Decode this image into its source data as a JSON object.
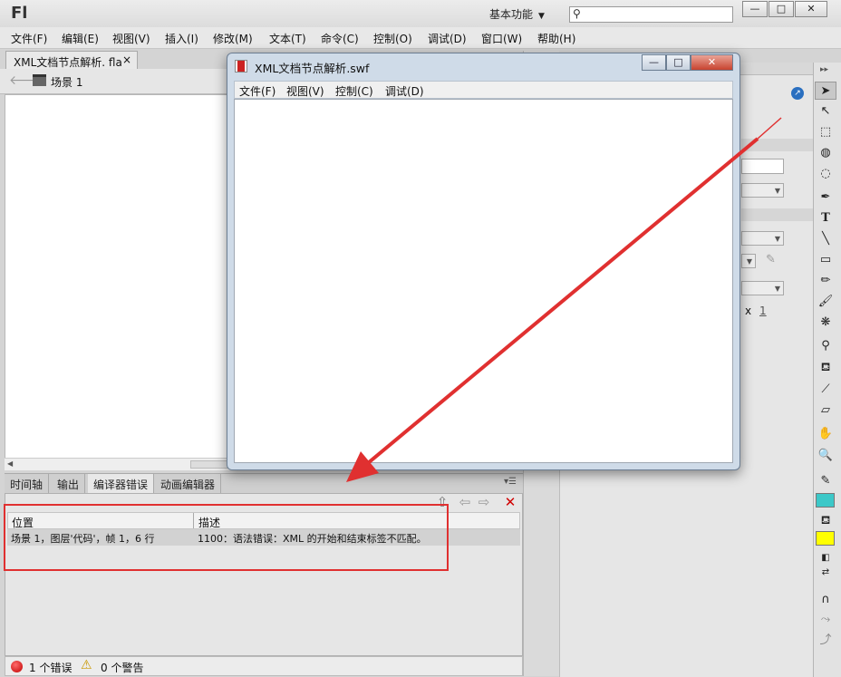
{
  "app": {
    "logo": "Fl",
    "workspace": "基本功能"
  },
  "window_buttons": {
    "minimize": "—",
    "maximize": "□",
    "close": "✕"
  },
  "menu": [
    "文件(F)",
    "编辑(E)",
    "视图(V)",
    "插入(I)",
    "修改(M)",
    "文本(T)",
    "命令(C)",
    "控制(O)",
    "调试(D)",
    "窗口(W)",
    "帮助(H)"
  ],
  "document": {
    "tab_title": "XML文档节点解析. fla",
    "tab_close": "×",
    "scene": "场景 1"
  },
  "bottom_panel": {
    "tabs": [
      "时间轴",
      "输出",
      "编译器错误",
      "动画编辑器"
    ],
    "active_tab": "编译器错误",
    "columns": [
      "位置",
      "描述"
    ],
    "rows": [
      {
        "location": "场景 1，图层'代码'，帧 1，6 行",
        "description": "1100：语法错误：XML 的开始和结束标签不匹配。"
      }
    ],
    "status": {
      "errors": "1 个错误",
      "warnings": "0 个警告"
    }
  },
  "swf_window": {
    "title": "XML文档节点解析.swf",
    "menu": [
      "文件(F)",
      "视图(V)",
      "控制(C)",
      "调试(D)"
    ]
  },
  "properties": {
    "x_label": "x",
    "x_value": "1"
  },
  "colors": {
    "annotation": "#e03030",
    "stroke_swatch": "#3cc8c8",
    "fill_swatch": "#ffff00"
  }
}
